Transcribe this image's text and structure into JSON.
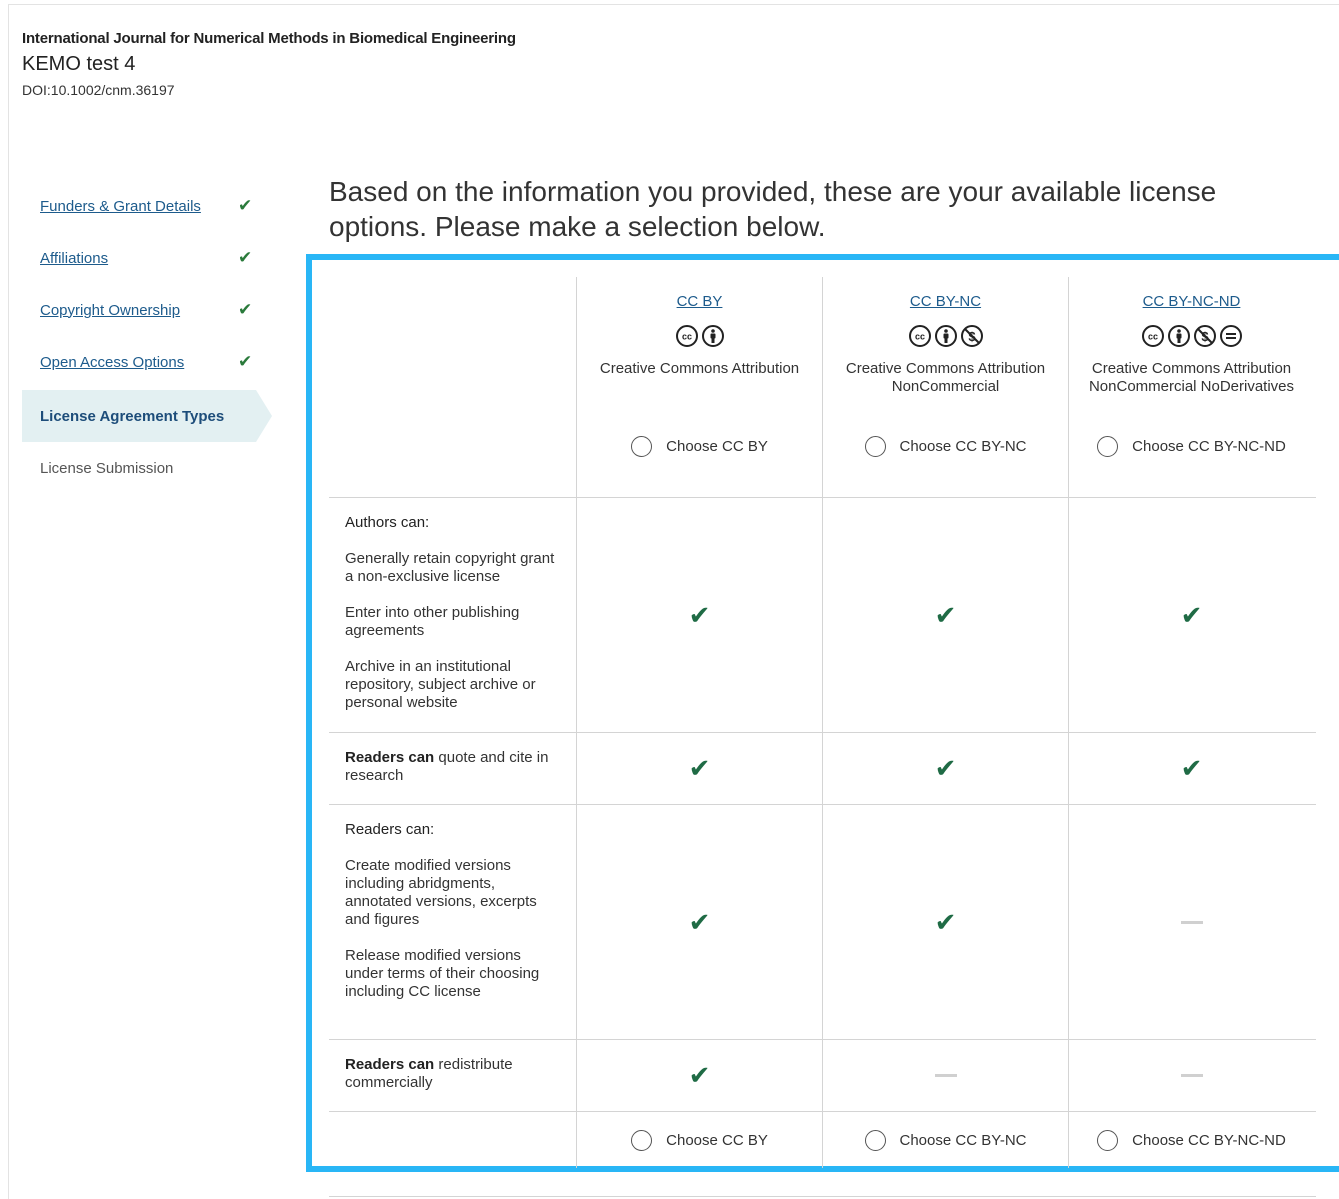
{
  "header": {
    "journal": "International Journal for Numerical Methods in Biomedical Engineering",
    "article_title": "KEMO test 4",
    "doi": "DOI:10.1002/cnm.36197"
  },
  "sidebar": {
    "items": [
      {
        "label": "Funders & Grant Details",
        "completed": true
      },
      {
        "label": "Affiliations",
        "completed": true
      },
      {
        "label": "Copyright Ownership",
        "completed": true
      },
      {
        "label": "Open Access Options",
        "completed": true
      },
      {
        "label": "License Agreement Types",
        "active": true
      },
      {
        "label": "License Submission"
      }
    ],
    "check_glyph": "✔"
  },
  "main": {
    "heading": "Based on the information you provided, these are your available license options. Please make a selection below."
  },
  "licenses": [
    {
      "code": "CC BY",
      "name": "Creative Commons Attribution",
      "choose_label": "Choose CC BY",
      "icons": [
        "cc-icon",
        "by-icon"
      ]
    },
    {
      "code": "CC BY-NC",
      "name": "Creative Commons Attribution NonCommercial",
      "choose_label": "Choose CC BY-NC",
      "icons": [
        "cc-icon",
        "by-icon",
        "nc-icon"
      ]
    },
    {
      "code": "CC BY-NC-ND",
      "name": "Creative Commons Attribution NonCommercial NoDerivatives",
      "choose_label": "Choose CC BY-NC-ND",
      "icons": [
        "cc-icon",
        "by-icon",
        "nc-icon",
        "nd-icon"
      ]
    }
  ],
  "features": {
    "authors_heading": "Authors can:",
    "authors_items": [
      "Generally retain copyright grant a non-exclusive license",
      "Enter into other publishing agreements",
      "Archive in an institutional repository, subject archive or personal website"
    ],
    "quote_bold": "Readers can",
    "quote_rest": " quote and cite in research",
    "readers_heading": "Readers can:",
    "readers_items": [
      "Create modified versions including abridgments, annotated versions, excerpts and figures",
      "Release modified versions under terms of their choosing including CC license"
    ],
    "redistribute_bold": "Readers can",
    "redistribute_rest": " redistribute commercially"
  },
  "matrix": {
    "authors": [
      "yes",
      "yes",
      "yes"
    ],
    "quote": [
      "yes",
      "yes",
      "yes"
    ],
    "modify": [
      "yes",
      "yes",
      "no"
    ],
    "redistribute": [
      "yes",
      "no",
      "no"
    ]
  },
  "colors": {
    "accent_border": "#29b6f6",
    "check_green": "#1f6b45",
    "link_blue": "#1d5b8c",
    "active_bg": "#e3f0f2"
  },
  "check_glyph": "✔"
}
